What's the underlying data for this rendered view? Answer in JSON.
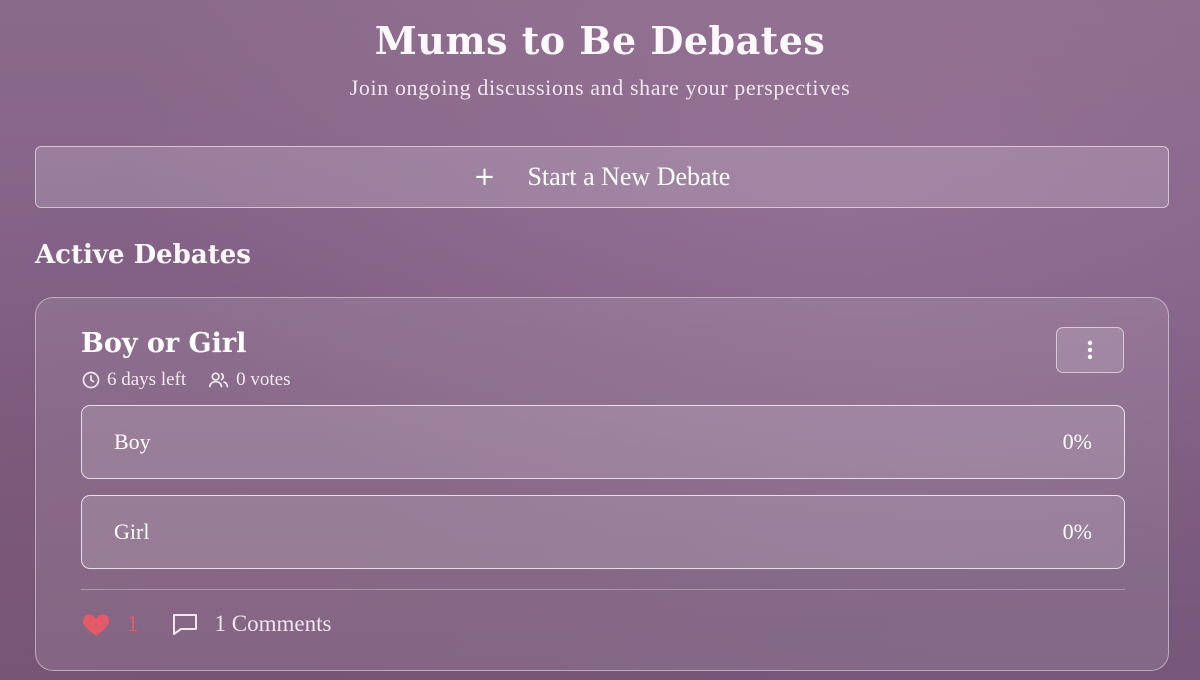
{
  "header": {
    "title": "Mums to Be Debates",
    "subtitle": "Join ongoing discussions and share your perspectives"
  },
  "new_debate": {
    "icon": "plus-icon",
    "plus_glyph": "+",
    "label": "Start a New Debate"
  },
  "section": {
    "title": "Active Debates"
  },
  "debate": {
    "title": "Boy or Girl",
    "time_left": "6 days left",
    "votes": "0 votes",
    "time_icon": "clock-icon",
    "votes_icon": "users-icon",
    "menu_icon": "more-vertical-icon",
    "options": [
      {
        "label": "Boy",
        "percent": "0%"
      },
      {
        "label": "Girl",
        "percent": "0%"
      }
    ],
    "likes": "1",
    "like_icon": "heart-icon",
    "comments": "1 Comments",
    "comment_icon": "message-square-icon"
  },
  "colors": {
    "background": "#85648a",
    "like_accent": "#e35a68",
    "text": "#ffffff"
  }
}
